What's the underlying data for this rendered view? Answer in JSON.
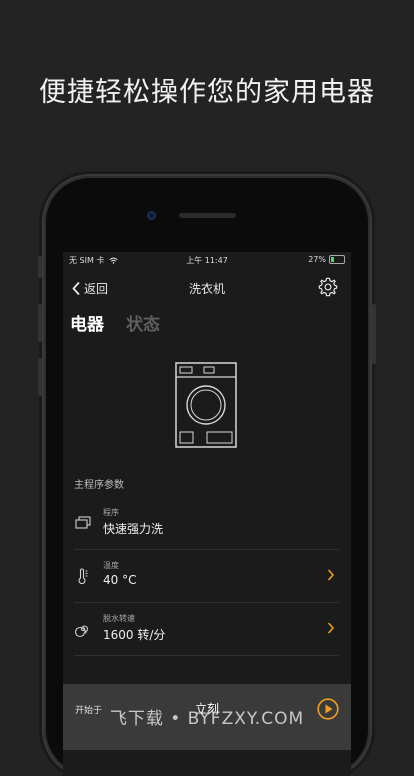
{
  "headline": "便捷轻松操作您的家用电器",
  "status_bar": {
    "carrier": "无 SIM 卡",
    "time": "上午 11:47",
    "battery": "27%"
  },
  "nav": {
    "back_label": "返回",
    "title": "洗衣机"
  },
  "tabs": [
    {
      "label": "电器",
      "active": true
    },
    {
      "label": "状态",
      "active": false
    }
  ],
  "section_label": "主程序参数",
  "params": [
    {
      "label": "程序",
      "value": "快速强力洗",
      "icon": "layers-icon",
      "has_chevron": false
    },
    {
      "label": "温度",
      "value": "40 °C",
      "icon": "thermometer-icon",
      "has_chevron": true
    },
    {
      "label": "脱水转速",
      "value": "1600 转/分",
      "icon": "spin-icon",
      "has_chevron": true
    }
  ],
  "start": {
    "label": "开始于",
    "value": "立刻"
  },
  "watermark": "飞下载 • BYFZXY.COM",
  "colors": {
    "accent": "#f0a020",
    "background": "#232323",
    "screen": "#1b1b1b"
  }
}
